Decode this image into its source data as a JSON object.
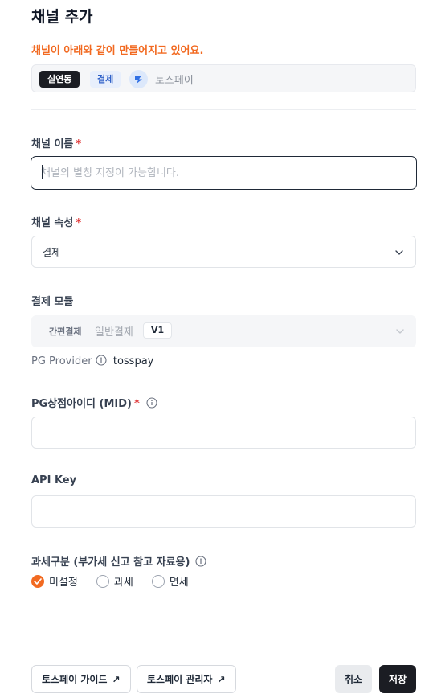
{
  "header": {
    "title": "채널 추가"
  },
  "notice": "채널이 아래와 같이 만들어지고 있어요.",
  "preview": {
    "env_badge": "실연동",
    "type_badge": "결제",
    "provider_name": "토스페이"
  },
  "channel_name": {
    "label": "채널 이름",
    "required_mark": "*",
    "placeholder": "채널의 별칭 지정이 가능합니다.",
    "value": ""
  },
  "channel_attr": {
    "label": "채널 속성",
    "required_mark": "*",
    "value": "결제"
  },
  "payment_module": {
    "label": "결제 모듈",
    "option_simple": "간편결제",
    "option_general": "일반결제",
    "version": "V1"
  },
  "pg_provider": {
    "label": "PG Provider",
    "value": "tosspay"
  },
  "mid": {
    "label": "PG상점아이디 (MID)",
    "required_mark": "*",
    "value": ""
  },
  "api_key": {
    "label": "API Key",
    "value": ""
  },
  "tax": {
    "label": "과세구분 (부가세 신고 참고 자료용)",
    "options": [
      {
        "label": "미설정",
        "checked": true
      },
      {
        "label": "과세",
        "checked": false
      },
      {
        "label": "면세",
        "checked": false
      }
    ]
  },
  "footer": {
    "guide_button": "토스페이 가이드",
    "admin_button": "토스페이 관리자",
    "link_arrow": "↗",
    "cancel_button": "취소",
    "save_button": "저장"
  },
  "colors": {
    "accent": "#f26a21",
    "required": "#e0393a",
    "dark": "#1b1d23"
  }
}
